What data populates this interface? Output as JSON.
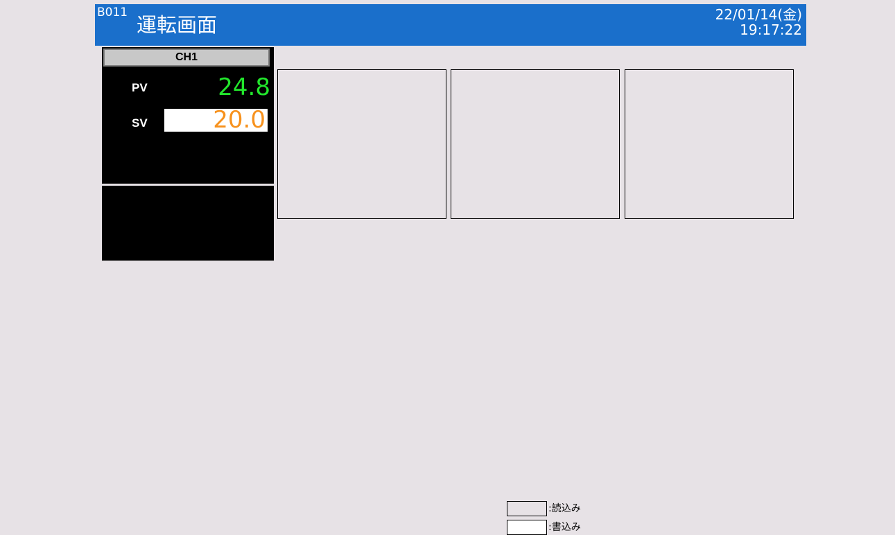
{
  "header": {
    "screen_code": "B011",
    "title": "運転画面",
    "date": "22/01/14(金)",
    "time": "19:17:22",
    "color": "#1a6fcb"
  },
  "channel": {
    "name": "CH1",
    "pv_label": "PV",
    "pv_value": "24.8",
    "sv_label": "SV",
    "sv_value": "20.0",
    "pv_color": "#22e62c",
    "sv_color": "#f7921e"
  },
  "legend": {
    "read_label": ":読込み",
    "write_label": ":書込み"
  },
  "colors": {
    "background": "#e7e2e6",
    "panel": "#000000"
  }
}
